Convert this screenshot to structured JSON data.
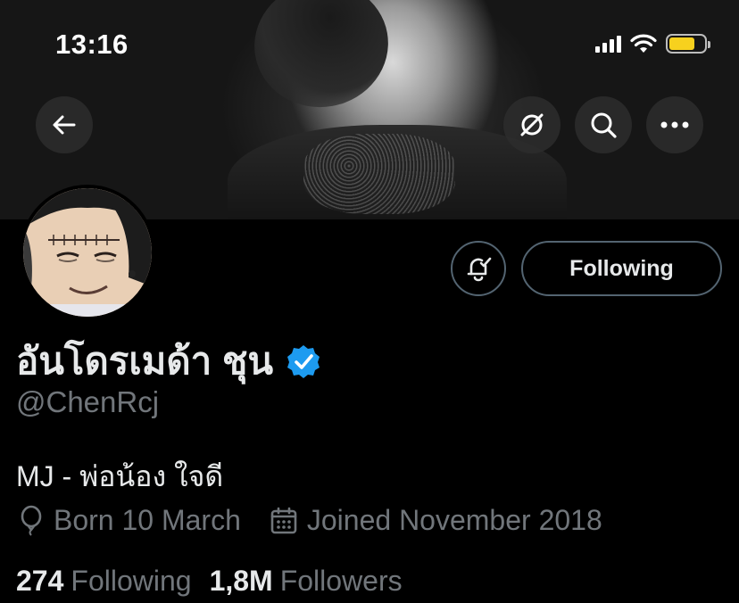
{
  "status_bar": {
    "time": "13:16",
    "signal_icon": "cellular-signal-icon",
    "wifi_icon": "wifi-icon",
    "battery_icon": "battery-icon",
    "battery_color": "#f7d11e"
  },
  "banner_actions": {
    "back_icon": "arrow-left-icon",
    "grok_icon": "grok-icon",
    "search_icon": "search-icon",
    "more_icon": "more-horizontal-icon"
  },
  "profile": {
    "display_name": "อันโดรเมด้า ชุน",
    "verified_badge": "verified-badge-icon",
    "verified_color": "#1d9bf0",
    "handle": "@ChenRcj",
    "bio": "MJ - พ่อน้อง ใจดี",
    "birthday": "Born 10 March",
    "joined": "Joined November 2018"
  },
  "actions": {
    "notify_icon": "bell-icon",
    "follow_label": "Following"
  },
  "stats": {
    "following_count": "274",
    "following_label": "Following",
    "followers_count": "1,8M",
    "followers_label": "Followers"
  }
}
